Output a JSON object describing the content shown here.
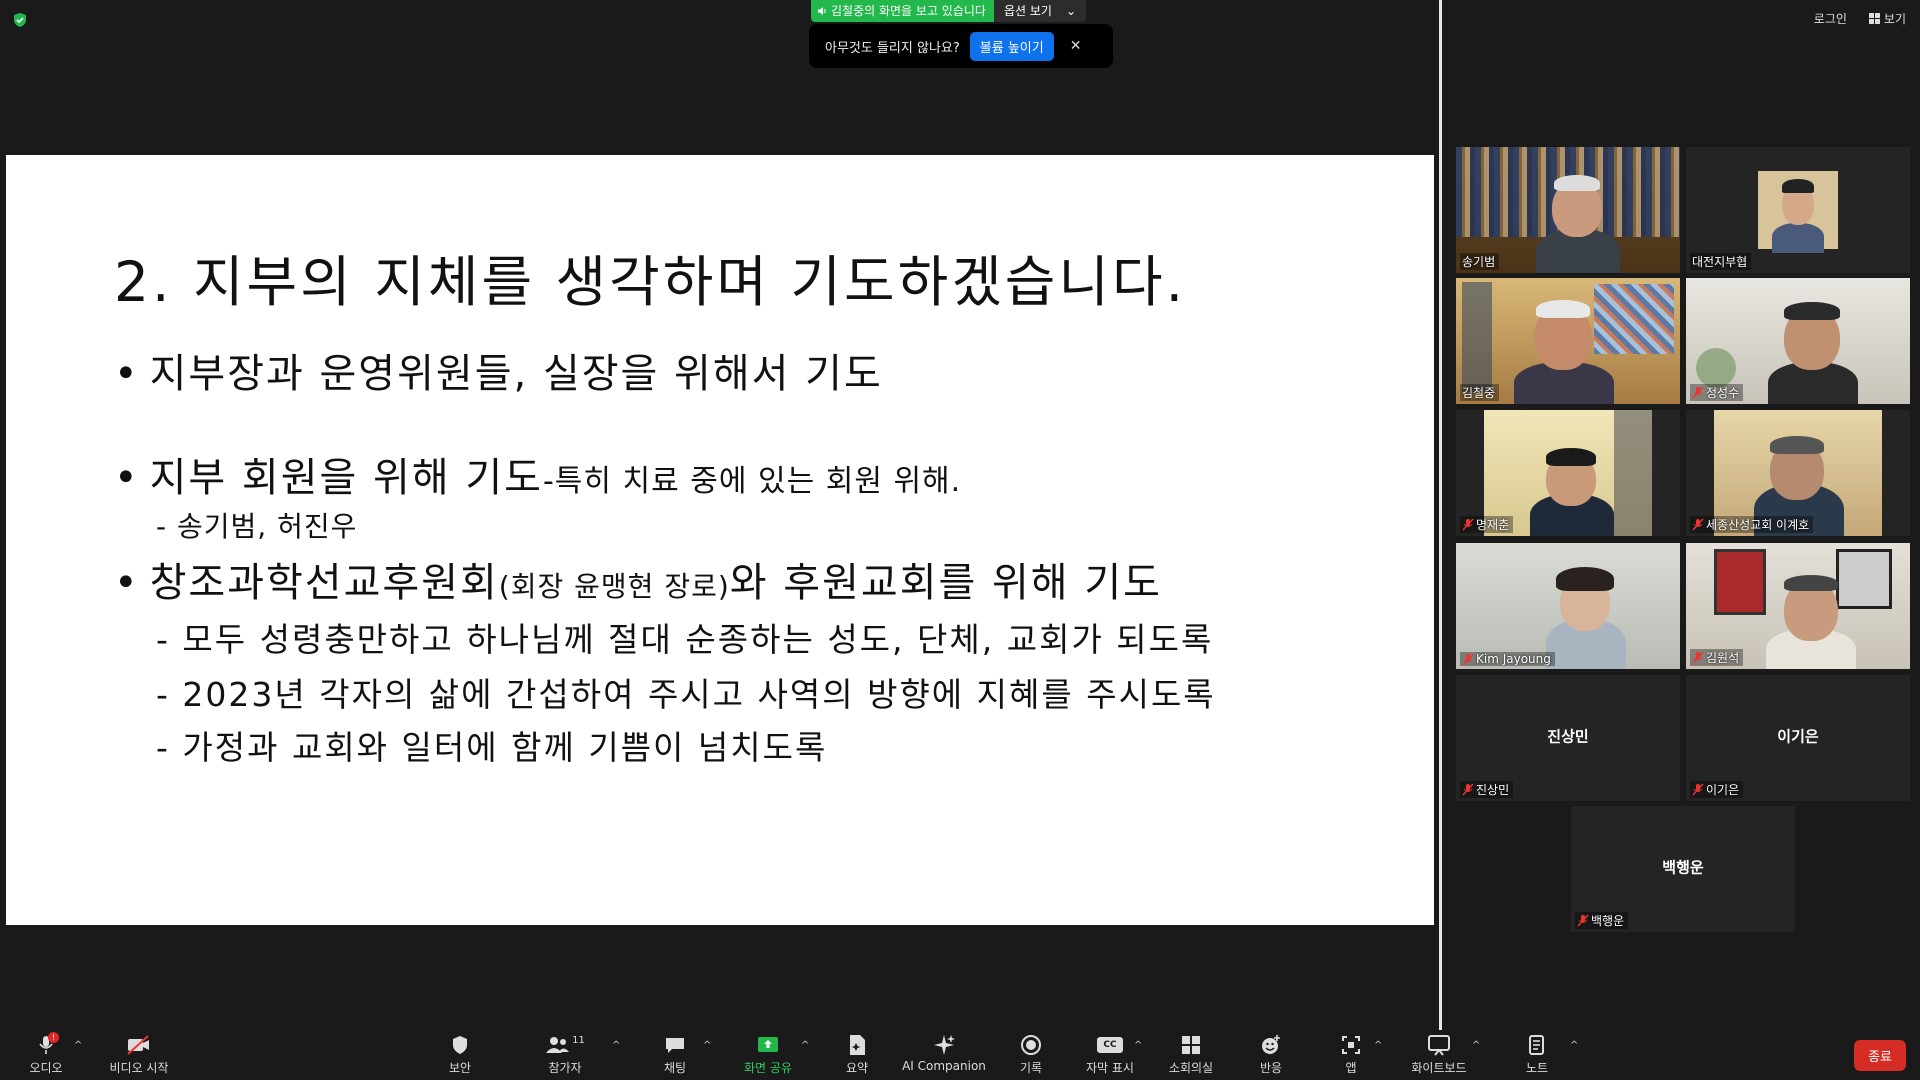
{
  "top": {
    "share_banner": "김철중의 화면을 보고 있습니다",
    "view_options": "옵션 보기",
    "audio_toast": {
      "message": "아무것도 들리지 않나요?",
      "button": "볼륨 높이기"
    },
    "login": "로그인",
    "view": "보기"
  },
  "slide": {
    "title": "2. 지부의 지체를 생각하며 기도하겠습니다.",
    "bullet1": "지부장과 운영위원들, 실장을 위해서 기도",
    "bullet2_main": "지부 회원을 위해 기도",
    "bullet2_tail": "-특히 치료 중에 있는 회원 위해.",
    "bullet2_sub": "- 송기범, 허진우",
    "bullet3_main": "창조과학선교후원회",
    "bullet3_paren": "(회장 윤맹현 장로)",
    "bullet3_tail": "와 후원교회를 위해 기도",
    "sub1": "- 모두 성령충만하고 하나님께 절대 순종하는 성도, 단체, 교회가 되도록",
    "sub2": "- 2023년 각자의 삶에 간섭하여 주시고 사역의 방향에 지혜를 주시도록",
    "sub3": "- 가정과 교회와 일터에 함께 기쁨이 넘치도록"
  },
  "participants": [
    {
      "name": "송기범"
    },
    {
      "name": "대전지부협"
    },
    {
      "name": "김철중"
    },
    {
      "name": "정성수"
    },
    {
      "name": "명재춘"
    },
    {
      "name": "세종산성교회 이계호"
    },
    {
      "name": "Kim Jayoung"
    },
    {
      "name": "김원석"
    },
    {
      "name": "진상민",
      "display": "진상민"
    },
    {
      "name": "이기은",
      "display": "이기은"
    },
    {
      "name": "백행운",
      "display": "백행운"
    }
  ],
  "toolbar": {
    "audio": "오디오",
    "video": "비디오 시작",
    "security": "보안",
    "participants": "참가자",
    "participants_count": "11",
    "chat": "채팅",
    "share": "화면 공유",
    "summary": "요약",
    "ai": "AI Companion",
    "record": "기록",
    "captions": "자막 표시",
    "breakout": "소회의실",
    "reactions": "반응",
    "apps": "앱",
    "whiteboard": "화이트보드",
    "notes": "노트",
    "end": "종료",
    "cc_glyph": "CC",
    "audio_badge": "!"
  },
  "colors": {
    "share_green": "#23b84c",
    "primary_blue": "#0e72ed",
    "end_red": "#d52c25",
    "active_speaker": "#e8e23a"
  }
}
